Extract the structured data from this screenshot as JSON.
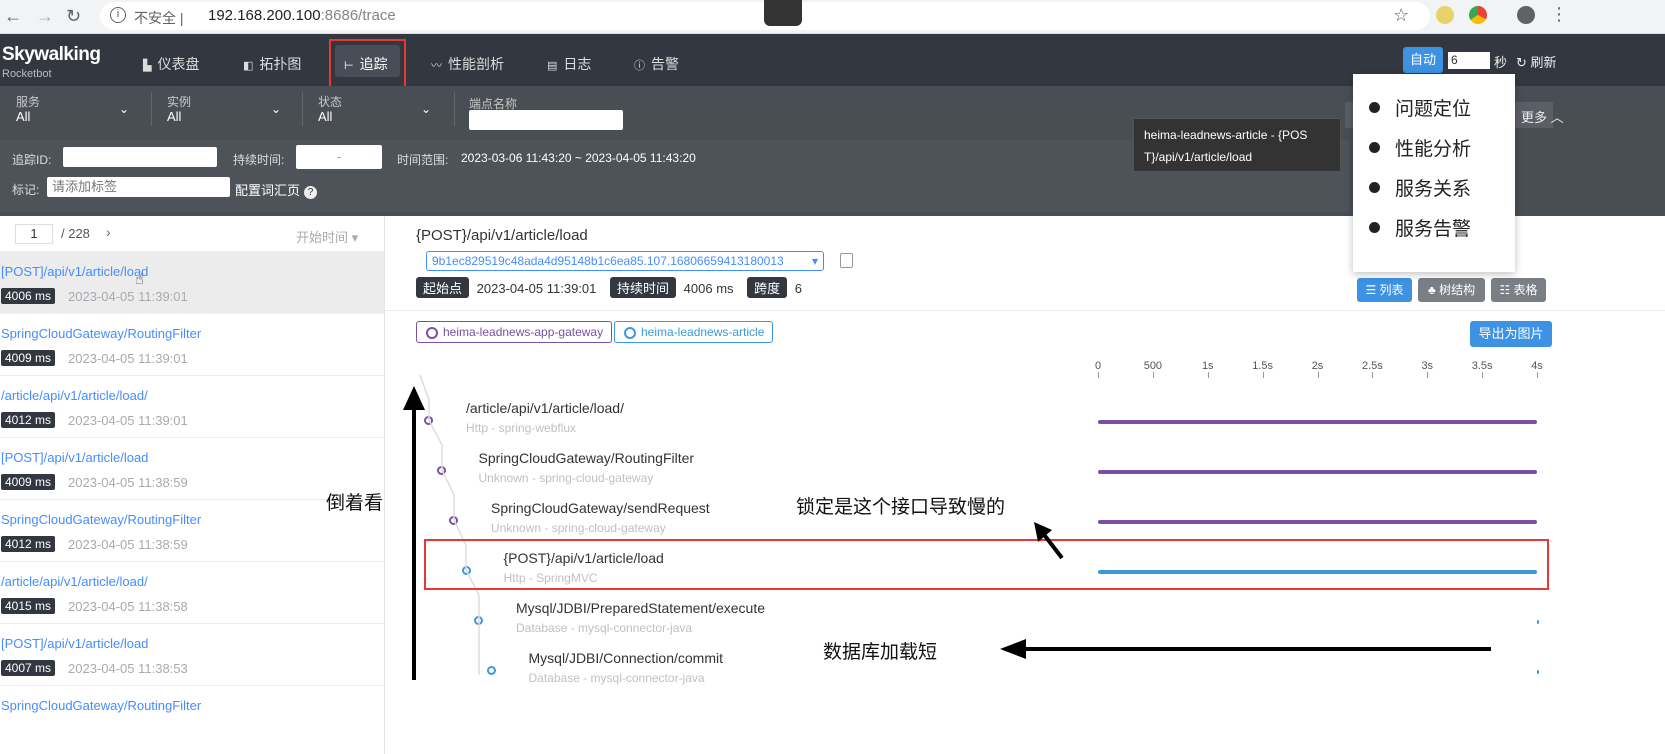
{
  "browser": {
    "insecure_label": "不安全 |",
    "url_host": "192.168.200.100",
    "url_rest": ":8686/trace"
  },
  "app": {
    "logo": "Skywalking",
    "logo_sub": "Rocketbot"
  },
  "nav": {
    "items": [
      {
        "label": "仪表盘",
        "icon": "bar-chart-icon"
      },
      {
        "label": "拓扑图",
        "icon": "topology-icon"
      },
      {
        "label": "追踪",
        "icon": "trace-icon"
      },
      {
        "label": "性能剖析",
        "icon": "profile-icon"
      },
      {
        "label": "日志",
        "icon": "log-icon"
      },
      {
        "label": "告警",
        "icon": "alarm-icon"
      }
    ],
    "active": "追踪",
    "auto_label": "自动",
    "interval_value": "6",
    "interval_unit": "秒",
    "refresh_label": "刷新"
  },
  "filters": {
    "service_label": "服务",
    "service_value": "All",
    "instance_label": "实例",
    "instance_value": "All",
    "status_label": "状态",
    "status_value": "All",
    "endpoint_label": "端点名称",
    "trace_id_label": "追踪ID:",
    "duration_label": "持续时间:",
    "duration_placeholder": "-",
    "time_range_label": "时间范围:",
    "time_range_value": "2023-03-06 11:43:20 ~ 2023-04-05 11:43:20",
    "tag_label": "标记:",
    "tag_placeholder": "请添加标签",
    "config_vocab_label": "配置词汇页",
    "more_label": "更多"
  },
  "tooltip": {
    "line1": "heima-leadnews-article - {POS",
    "line2": "T}/api/v1/article/load"
  },
  "popup_menu": {
    "items": [
      "问题定位",
      "性能分析",
      "服务关系",
      "服务告警"
    ]
  },
  "trace_list": {
    "page": "1",
    "total_pages": "/ 228",
    "sort_label": "开始时间",
    "items": [
      {
        "name": "[POST]/api/v1/article/load",
        "duration": "4006 ms",
        "time": "2023-04-05 11:39:01"
      },
      {
        "name": "SpringCloudGateway/RoutingFilter",
        "duration": "4009 ms",
        "time": "2023-04-05 11:39:01"
      },
      {
        "name": "/article/api/v1/article/load/",
        "duration": "4012 ms",
        "time": "2023-04-05 11:39:01"
      },
      {
        "name": "[POST]/api/v1/article/load",
        "duration": "4009 ms",
        "time": "2023-04-05 11:38:59"
      },
      {
        "name": "SpringCloudGateway/RoutingFilter",
        "duration": "4012 ms",
        "time": "2023-04-05 11:38:59"
      },
      {
        "name": "/article/api/v1/article/load/",
        "duration": "4015 ms",
        "time": "2023-04-05 11:38:58"
      },
      {
        "name": "[POST]/api/v1/article/load",
        "duration": "4007 ms",
        "time": "2023-04-05 11:38:53"
      },
      {
        "name": "SpringCloudGateway/RoutingFilter",
        "duration": "",
        "time": ""
      }
    ]
  },
  "detail": {
    "title": "{POST}/api/v1/article/load",
    "trace_id": "9b1ec829519c48ada4d95148b1c6ea85.107.16806659413180013",
    "start_label": "起始点",
    "start_value": "2023-04-05 11:39:01",
    "duration_label": "持续时间",
    "duration_value": "4006 ms",
    "span_label": "跨度",
    "span_value": "6",
    "view_list": "列表",
    "view_tree": "树结构",
    "view_table": "表格",
    "export_label": "导出为图片",
    "services": [
      {
        "name": "heima-leadnews-app-gateway",
        "color": "#7b4fa3"
      },
      {
        "name": "heima-leadnews-article",
        "color": "#3a9ad9"
      }
    ],
    "axis_ticks": [
      "0",
      "500",
      "1s",
      "1.5s",
      "2s",
      "2.5s",
      "3s",
      "3.5s",
      "4s"
    ],
    "total_ms": 4006,
    "spans": [
      {
        "name": "/article/api/v1/article/load/",
        "sub": "Http - spring-webflux",
        "start": 0,
        "duration": 4006,
        "color": "#7b4fa3"
      },
      {
        "name": "SpringCloudGateway/RoutingFilter",
        "sub": "Unknown - spring-cloud-gateway",
        "start": 0,
        "duration": 4006,
        "color": "#7b4fa3"
      },
      {
        "name": "SpringCloudGateway/sendRequest",
        "sub": "Unknown - spring-cloud-gateway",
        "start": 0,
        "duration": 4006,
        "color": "#7b4fa3"
      },
      {
        "name": "{POST}/api/v1/article/load",
        "sub": "Http - SpringMVC",
        "start": 0,
        "duration": 4006,
        "color": "#3a9ad9"
      },
      {
        "name": "Mysql/JDBI/PreparedStatement/execute",
        "sub": "Database - mysql-connector-java",
        "start": 4000,
        "duration": 4,
        "color": "#3a9ad9"
      },
      {
        "name": "Mysql/JDBI/Connection/commit",
        "sub": "Database - mysql-connector-java",
        "start": 4000,
        "duration": 2,
        "color": "#3a9ad9"
      }
    ]
  },
  "annotations": {
    "reverse_look": "倒着看",
    "locked_slow": "锁定是这个接口导致慢的",
    "db_short": "数据库加载短"
  },
  "colors": {
    "accent": "#3d92e3",
    "nav_bg": "#333840",
    "highlight": "#e53935"
  }
}
